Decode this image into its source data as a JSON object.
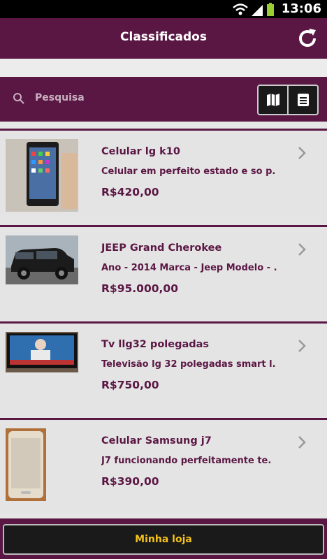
{
  "status": {
    "time": "13:06"
  },
  "header": {
    "title": "Classificados"
  },
  "search": {
    "placeholder": "Pesquisa"
  },
  "listings": [
    {
      "title": "Celular lg k10",
      "description": "Celular em perfeito estado e so p.",
      "price": "R$420,00"
    },
    {
      "title": "JEEP Grand Cherokee",
      "description": "Ano - 2014 Marca - Jeep Modelo - .",
      "price": "R$95.000,00"
    },
    {
      "title": "Tv llg32 polegadas",
      "description": "Televisão lg 32 polegadas smart l.",
      "price": "R$750,00"
    },
    {
      "title": "Celular Samsung j7",
      "description": "J7 funcionando perfeitamente te.",
      "price": "R$390,00"
    }
  ],
  "footer": {
    "button_label": "Minha loja"
  },
  "colors": {
    "primary": "#5b1744",
    "accent": "#f5c21b"
  }
}
